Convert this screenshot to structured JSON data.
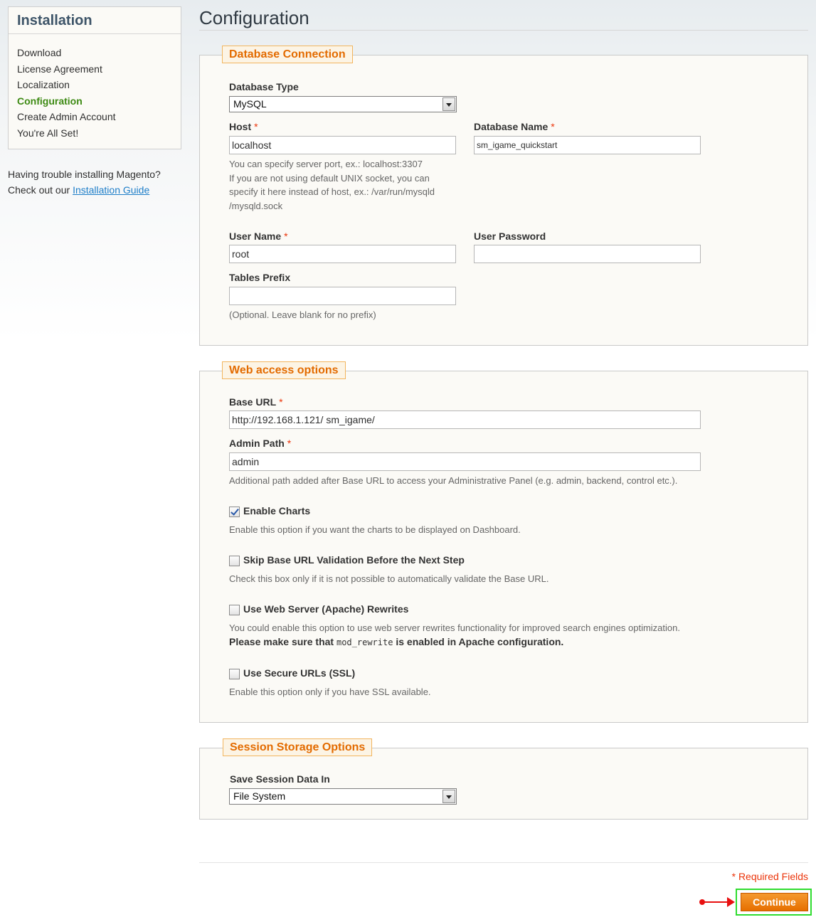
{
  "sidebar": {
    "title": "Installation",
    "steps": [
      {
        "label": "Download",
        "active": false
      },
      {
        "label": "License Agreement",
        "active": false
      },
      {
        "label": "Localization",
        "active": false
      },
      {
        "label": "Configuration",
        "active": true
      },
      {
        "label": "Create Admin Account",
        "active": false
      },
      {
        "label": "You're All Set!",
        "active": false
      }
    ],
    "help_line1": "Having trouble installing Magento?",
    "help_line2_prefix": "Check out our ",
    "help_link": "Installation Guide"
  },
  "page": {
    "title": "Configuration"
  },
  "database": {
    "legend": "Database Connection",
    "type_label": "Database Type",
    "type_value": "MySQL",
    "host_label": "Host",
    "host_value": "localhost",
    "host_note_1": "You can specify server port, ex.: localhost:3307",
    "host_note_2": "If you are not using default UNIX socket, you can",
    "host_note_3": "specify it here instead of host, ex.: /var/run/mysqld",
    "host_note_4": "/mysqld.sock",
    "name_label": "Database Name",
    "name_value": "sm_igame_quickstart",
    "user_label": "User Name",
    "user_value": "root",
    "password_label": "User Password",
    "password_value": "",
    "prefix_label": "Tables Prefix",
    "prefix_value": "",
    "prefix_note": "(Optional. Leave blank for no prefix)",
    "required_mark": "*"
  },
  "web": {
    "legend": "Web access options",
    "base_url_label": "Base URL",
    "base_url_value": "http://192.168.1.121/ sm_igame/",
    "admin_path_label": "Admin Path",
    "admin_path_value": "admin",
    "admin_path_note": "Additional path added after Base URL to access your Administrative Panel (e.g. admin, backend, control etc.).",
    "charts_label": "Enable Charts",
    "charts_checked": true,
    "charts_note": "Enable this option if you want the charts to be displayed on Dashboard.",
    "skip_label": "Skip Base URL Validation Before the Next Step",
    "skip_checked": false,
    "skip_note": "Check this box only if it is not possible to automatically validate the Base URL.",
    "rewrites_label": "Use Web Server (Apache) Rewrites",
    "rewrites_checked": false,
    "rewrites_note": "You could enable this option to use web server rewrites functionality for improved search engines optimization.",
    "rewrites_note2_prefix": "Please make sure that ",
    "rewrites_note2_code": "mod_rewrite",
    "rewrites_note2_suffix": " is enabled in Apache configuration.",
    "ssl_label": "Use Secure URLs (SSL)",
    "ssl_checked": false,
    "ssl_note": "Enable this option only if you have SSL available."
  },
  "session": {
    "legend": "Session Storage Options",
    "save_label": "Save Session Data In",
    "save_value": "File System"
  },
  "footer": {
    "required_fields": "* Required Fields",
    "continue_label": "Continue"
  },
  "colors": {
    "legend_text": "#e36b00",
    "required": "#eb340a",
    "active_step": "#3d8a13",
    "continue_bg": "#f08200",
    "highlight_frame": "#2fdc2f",
    "annotation_arrow": "#e81010"
  }
}
